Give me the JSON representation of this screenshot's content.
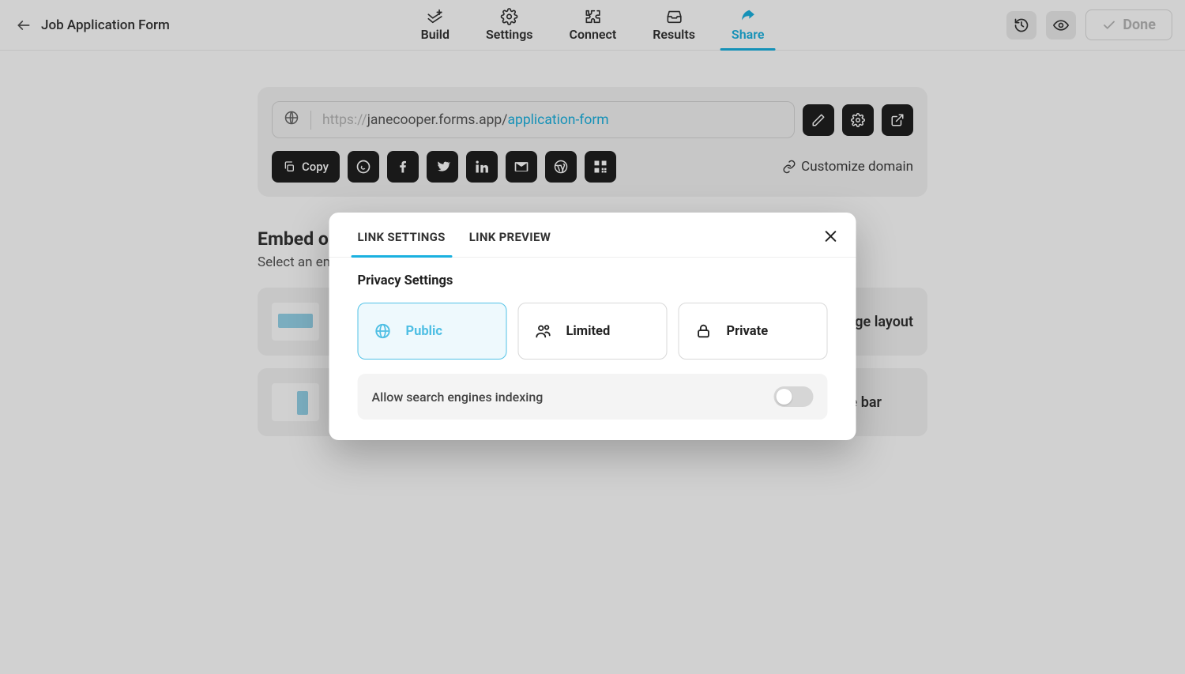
{
  "header": {
    "form_title": "Job Application Form",
    "tabs": {
      "build": "Build",
      "settings": "Settings",
      "connect": "Connect",
      "results": "Results",
      "share": "Share"
    },
    "done_label": "Done"
  },
  "share_panel": {
    "url_prefix": "https://",
    "url_host": "janecooper.forms.app/",
    "url_slug": "application-form",
    "copy_label": "Copy",
    "customize_label": "Customize domain"
  },
  "embed": {
    "title": "Embed on your website",
    "subtitle": "Select an embed option",
    "cards": {
      "full": "Full page layout",
      "side": "Side bar"
    }
  },
  "modal": {
    "tabs": {
      "settings": "LINK SETTINGS",
      "preview": "LINK PREVIEW"
    },
    "section_title": "Privacy Settings",
    "options": {
      "public": "Public",
      "limited": "Limited",
      "private": "Private"
    },
    "toggle_label": "Allow search engines indexing"
  }
}
